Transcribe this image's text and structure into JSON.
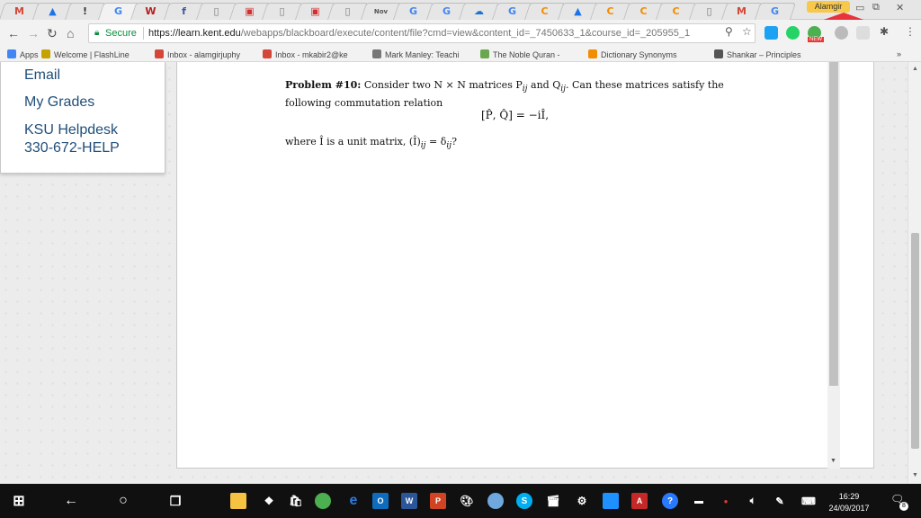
{
  "browser": {
    "tabs": [
      {
        "icon": "M",
        "color": "#d44638"
      },
      {
        "icon": "▲",
        "color": "#1a73e8"
      },
      {
        "icon": "!",
        "color": "#333"
      },
      {
        "icon": "G",
        "color": "#4285f4"
      },
      {
        "icon": "W",
        "color": "#b71c1c"
      },
      {
        "icon": "f",
        "color": "#3b5998"
      },
      {
        "icon": "▯",
        "color": "#777"
      },
      {
        "icon": "▣",
        "color": "#d32f2f"
      },
      {
        "icon": "▯",
        "color": "#777"
      },
      {
        "icon": "▣",
        "color": "#d32f2f"
      },
      {
        "icon": "▯",
        "color": "#777"
      },
      {
        "icon": "Nov",
        "color": "#555"
      },
      {
        "icon": "G",
        "color": "#4285f4"
      },
      {
        "icon": "G",
        "color": "#4285f4"
      },
      {
        "icon": "☁",
        "color": "#1976d2"
      },
      {
        "icon": "G",
        "color": "#4285f4"
      },
      {
        "icon": "C",
        "color": "#f28c00"
      },
      {
        "icon": "▲",
        "color": "#1a73e8"
      },
      {
        "icon": "C",
        "color": "#f28c00"
      },
      {
        "icon": "C",
        "color": "#f28c00"
      },
      {
        "icon": "C",
        "color": "#f28c00"
      },
      {
        "icon": "▯",
        "color": "#777"
      },
      {
        "icon": "M",
        "color": "#d44638"
      },
      {
        "icon": "G",
        "color": "#4285f4"
      }
    ],
    "profile_name": "Alamgir",
    "secure_label": "Secure",
    "url_base": "https://learn.kent.edu",
    "url_path": "/webapps/blackboard/execute/content/file?cmd=view&content_id=_7450633_1&course_id=_205955_1",
    "new_badge": "NEW"
  },
  "bookmarks": [
    {
      "label": "Apps",
      "color": "#4285f4"
    },
    {
      "label": "Welcome | FlashLine",
      "color": "#c5a200"
    },
    {
      "label": "Inbox - alamgirjuphy",
      "color": "#d44638"
    },
    {
      "label": "Inbox - mkabir2@ke",
      "color": "#d44638"
    },
    {
      "label": "Mark Manley: Teachi",
      "color": "#777"
    },
    {
      "label": "The Noble Quran - ",
      "color": "#6aa84f"
    },
    {
      "label": "Dictionary Synonyms",
      "color": "#f28c00"
    },
    {
      "label": "Shankar – Principles",
      "color": "#555"
    }
  ],
  "bookmarks_more": "»",
  "sidebar": {
    "email": "Email",
    "grades": "My Grades",
    "helpdesk": "KSU Helpdesk",
    "phone": "330-672-HELP"
  },
  "problem": {
    "heading": "Problem #10:",
    "text": "Consider two N × N matrices P",
    "line1_rest": " and Q",
    "line1_end": ". Can these matrices satisfy the",
    "line2": "following commutation relation",
    "equation": "[P̂, Q̂] = −iÎ,",
    "where": "where Î is a unit matrix, (Î)",
    "where_end": " = δ",
    "where_q": "?"
  },
  "taskbar": {
    "time": "16:29",
    "date": "24/09/2017",
    "notification_count": "8"
  }
}
